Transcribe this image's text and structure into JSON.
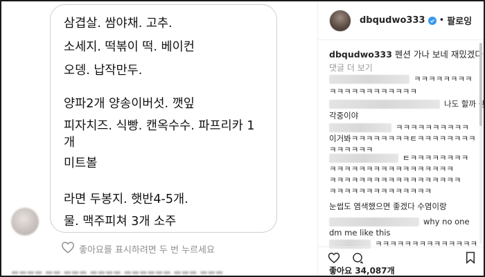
{
  "post_text": {
    "lines": [
      "삼겹살. 쌈야채. 고추.",
      "소세지. 떡볶이 떡. 베이컨",
      "오뎅. 납작만두.",
      "",
      "양파2개 양송이버섯. 깻잎",
      "피자치즈. 식빵. 캔옥수수. 파프리카 1",
      "개",
      "미트볼",
      "",
      "라면 두봉지. 햇반4-5개.",
      "물. 맥주피쳐 3개 소주"
    ]
  },
  "like_prompt": "좋아요를 표시하려면 두 번 누르세요",
  "header": {
    "username": "dbqudwo333",
    "separator": "•",
    "follow_label": "팔로잉"
  },
  "caption": {
    "username": "dbqudwo333",
    "text": "펜션 가나 보네 재밌겠다"
  },
  "more_comments": "댓글 더 보기",
  "comments": [
    {
      "text": "ㅋㅋㅋㅋㅋㅋㅋㅋ"
    },
    {
      "text": "ㅋㅋㅋㅋㅋㅋㅋㅋㅋㅋㅋㅋ"
    },
    {
      "text": "나도 할까 생"
    },
    {
      "text": "각중이야"
    },
    {
      "text": "ㅋㅋㅋㅋㅋㅋㅋㅋㅋㅋ"
    },
    {
      "text": "이거봐ㅋㅋㅋㅋㅋㅋㅋㅋㅌㅋㅋㅋㅋㅋㅋㅋㅋ"
    },
    {
      "text": "ㅋㅋㅋㅋㅋㅋ"
    },
    {
      "text": "ㅌㅋㅋㅋㅋㅋㅋㅋㅋ"
    },
    {
      "text": "ㅋㅋㅋㅋㅋㅋㅋㅋㅋㅋㅋㅋㅋㅋㅋㅋㅋ"
    },
    {
      "text": "ㅋㅋㅋㅋㅋㅋㅋㅋㅋㅋㅋㅋㅋㅋㅋㅋㅋㅋ"
    },
    {
      "text": "ㅋㅋㅋㅋㅋㅋㅋㅋㅋㅋㅋㅋㅋㅋ"
    },
    {
      "text": "눈썹도 염색했으면 좋겠다 수염이랑"
    },
    {
      "text": "why no one"
    },
    {
      "text": "dm me like this"
    },
    {
      "text": "ㅋㅋㅋㅋㅋㅋㅋㅋㅋㅋㅋㅋㅋㅋ"
    }
  ],
  "likes": {
    "label": "좋아요",
    "count": "34,087개"
  },
  "colors": {
    "verified": "#3897f0",
    "muted": "#8e8e8e",
    "border": "#efefef"
  }
}
